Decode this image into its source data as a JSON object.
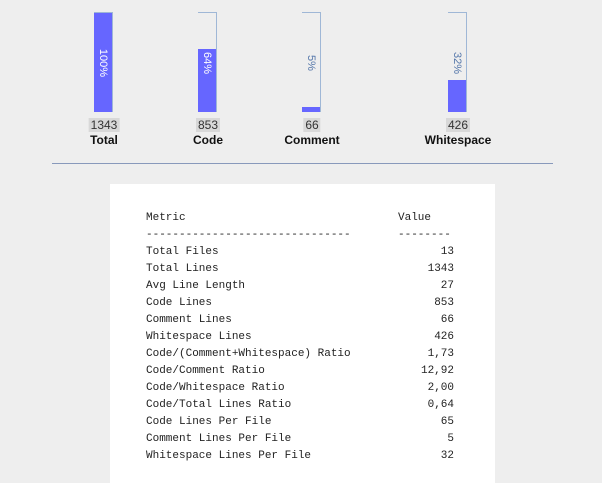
{
  "bars": [
    {
      "pct_label": "100%",
      "fraction": 1.0,
      "count": "1343",
      "name": "Total"
    },
    {
      "pct_label": "64%",
      "fraction": 0.64,
      "count": "853",
      "name": "Code"
    },
    {
      "pct_label": "5%",
      "fraction": 0.05,
      "count": "66",
      "name": "Comment"
    },
    {
      "pct_label": "32%",
      "fraction": 0.32,
      "count": "426",
      "name": "Whitespace"
    }
  ],
  "table": {
    "header": {
      "metric": "Metric",
      "value": "Value"
    },
    "rule": {
      "metric": "-------------------------------",
      "value": "--------"
    },
    "rows": [
      {
        "metric": "Total Files",
        "value": "13"
      },
      {
        "metric": "Total Lines",
        "value": "1343"
      },
      {
        "metric": "Avg Line Length",
        "value": "27"
      },
      {
        "metric": "Code Lines",
        "value": "853"
      },
      {
        "metric": "Comment Lines",
        "value": "66"
      },
      {
        "metric": "Whitespace Lines",
        "value": "426"
      },
      {
        "metric": "Code/(Comment+Whitespace) Ratio",
        "value": "1,73"
      },
      {
        "metric": "Code/Comment Ratio",
        "value": "12,92"
      },
      {
        "metric": "Code/Whitespace Ratio",
        "value": "2,00"
      },
      {
        "metric": "Code/Total Lines Ratio",
        "value": "0,64"
      },
      {
        "metric": "Code Lines Per File",
        "value": "65"
      },
      {
        "metric": "Comment Lines Per File",
        "value": "5"
      },
      {
        "metric": "Whitespace Lines Per File",
        "value": "32"
      }
    ]
  },
  "colors": {
    "bar_fill": "#6666ff",
    "separator": "#8899bb",
    "panel_bg": "#ffffff",
    "page_bg": "#eeeeee"
  }
}
